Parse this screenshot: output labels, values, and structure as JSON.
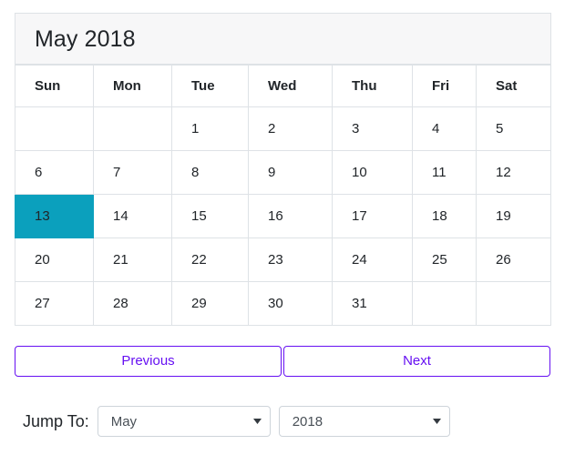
{
  "calendar": {
    "title": "May 2018",
    "weekday_headers": [
      "Sun",
      "Mon",
      "Tue",
      "Wed",
      "Thu",
      "Fri",
      "Sat"
    ],
    "weeks": [
      [
        {
          "label": "",
          "type": "blank"
        },
        {
          "label": "",
          "type": "blank"
        },
        {
          "label": "1",
          "type": "day"
        },
        {
          "label": "2",
          "type": "day"
        },
        {
          "label": "3",
          "type": "day"
        },
        {
          "label": "4",
          "type": "day"
        },
        {
          "label": "5",
          "type": "day"
        }
      ],
      [
        {
          "label": "6",
          "type": "day"
        },
        {
          "label": "7",
          "type": "day"
        },
        {
          "label": "8",
          "type": "day"
        },
        {
          "label": "9",
          "type": "day"
        },
        {
          "label": "10",
          "type": "day"
        },
        {
          "label": "11",
          "type": "day"
        },
        {
          "label": "12",
          "type": "day"
        }
      ],
      [
        {
          "label": "13",
          "type": "selected"
        },
        {
          "label": "14",
          "type": "day"
        },
        {
          "label": "15",
          "type": "day"
        },
        {
          "label": "16",
          "type": "day"
        },
        {
          "label": "17",
          "type": "day"
        },
        {
          "label": "18",
          "type": "day"
        },
        {
          "label": "19",
          "type": "day"
        }
      ],
      [
        {
          "label": "20",
          "type": "day"
        },
        {
          "label": "21",
          "type": "day"
        },
        {
          "label": "22",
          "type": "day"
        },
        {
          "label": "23",
          "type": "day"
        },
        {
          "label": "24",
          "type": "day"
        },
        {
          "label": "25",
          "type": "day"
        },
        {
          "label": "26",
          "type": "day"
        }
      ],
      [
        {
          "label": "27",
          "type": "day"
        },
        {
          "label": "28",
          "type": "day"
        },
        {
          "label": "29",
          "type": "day"
        },
        {
          "label": "30",
          "type": "day"
        },
        {
          "label": "31",
          "type": "day"
        },
        {
          "label": "",
          "type": "void"
        },
        {
          "label": "",
          "type": "void"
        }
      ]
    ],
    "selected_day": "13",
    "selected_color": "#0ba0bd",
    "header_background": "#f7f7f8",
    "border_color": "#dee2e6"
  },
  "navigation": {
    "previous_label": "Previous",
    "next_label": "Next",
    "accent_color": "#6610f2"
  },
  "jump_to": {
    "label": "Jump To:",
    "month_select": {
      "value": "May",
      "icon": "chevron-down-icon"
    },
    "year_select": {
      "value": "2018",
      "icon": "chevron-down-icon"
    }
  }
}
